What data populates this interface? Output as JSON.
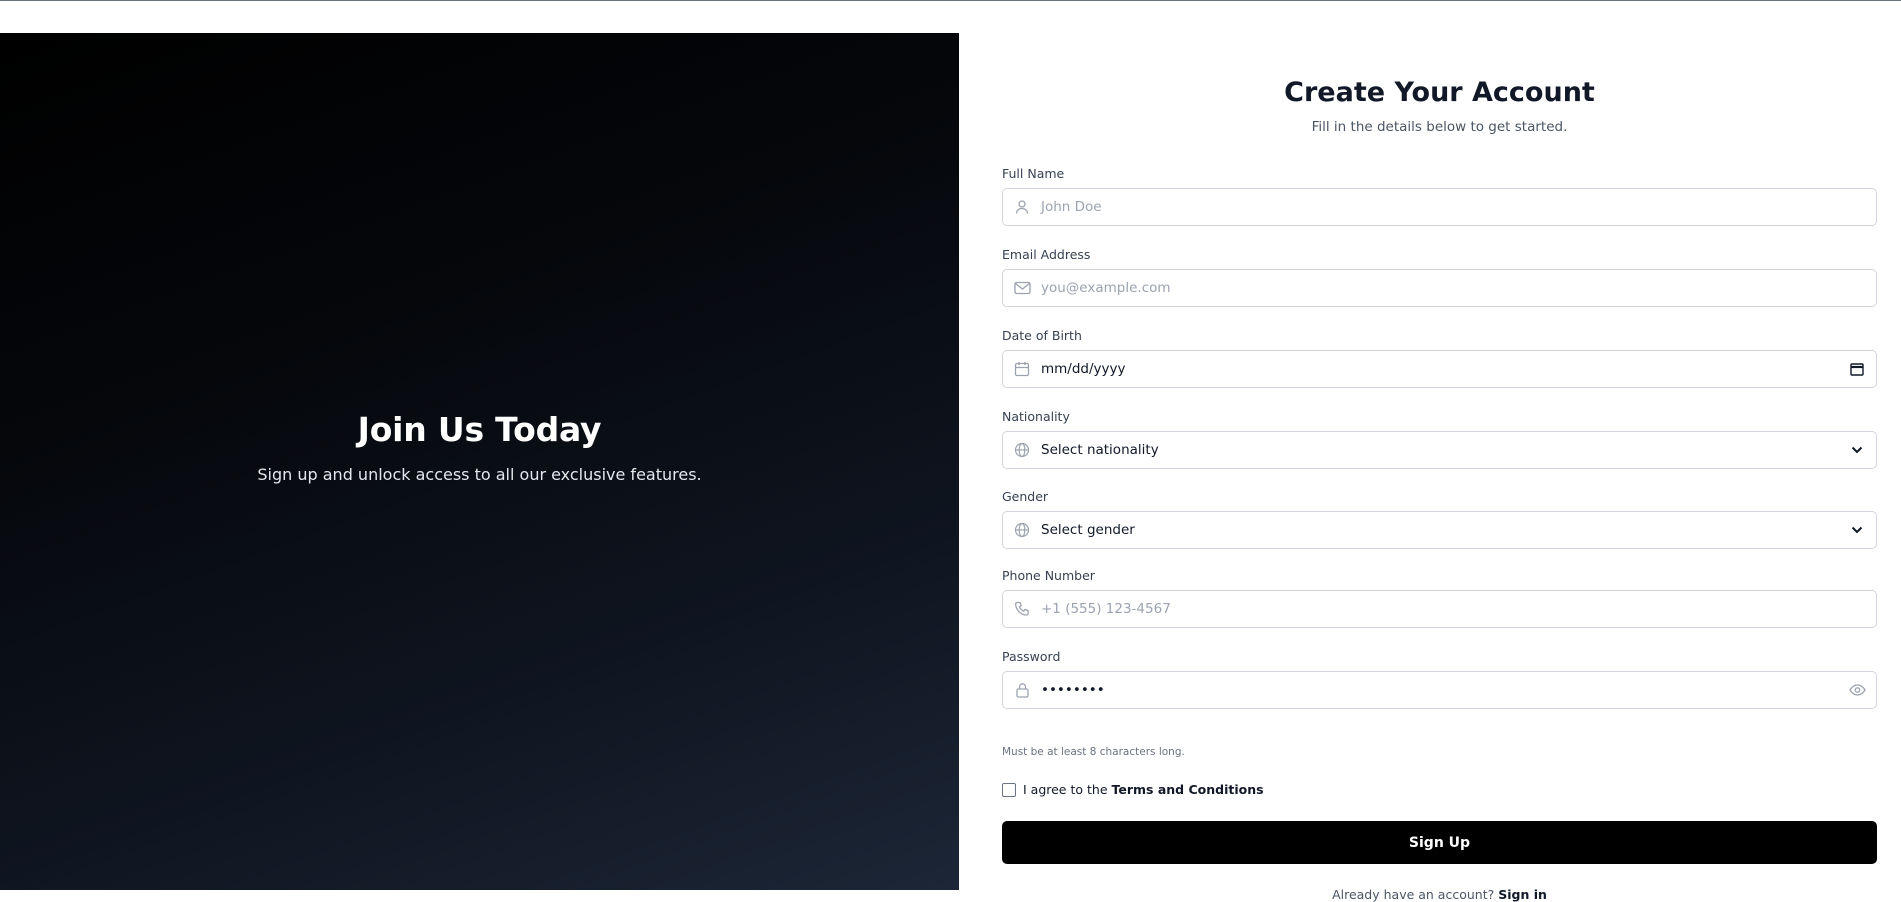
{
  "hero": {
    "title": "Join Us Today",
    "subtitle": "Sign up and unlock access to all our exclusive features."
  },
  "form": {
    "title": "Create Your Account",
    "subtitle": "Fill in the details below to get started.",
    "fields": {
      "full_name": {
        "label": "Full Name",
        "placeholder": "John Doe",
        "icon": "user-icon"
      },
      "email": {
        "label": "Email Address",
        "placeholder": "you@example.com",
        "icon": "mail-icon"
      },
      "dob": {
        "label": "Date of Birth",
        "value": "mm/dd/yyyy",
        "icon": "calendar-icon"
      },
      "nationality": {
        "label": "Nationality",
        "selected": "Select nationality",
        "icon": "globe-icon"
      },
      "gender": {
        "label": "Gender",
        "selected": "Select gender",
        "icon": "globe-icon"
      },
      "phone": {
        "label": "Phone Number",
        "placeholder": "+1 (555) 123-4567",
        "icon": "phone-icon"
      },
      "password": {
        "label": "Password",
        "value": "••••••••",
        "icon": "lock-icon",
        "hint": "Must be at least 8 characters long."
      }
    },
    "agree": {
      "text": "I agree to the",
      "link": "Terms and Conditions",
      "checked": false
    },
    "submit_label": "Sign Up",
    "signin": {
      "text": "Already have an account?",
      "link": "Sign in"
    }
  },
  "colors": {
    "accent": "#000000",
    "border": "#d1d5db",
    "placeholder": "#9ca3af",
    "hero_gradient_end": "#1c2636"
  }
}
